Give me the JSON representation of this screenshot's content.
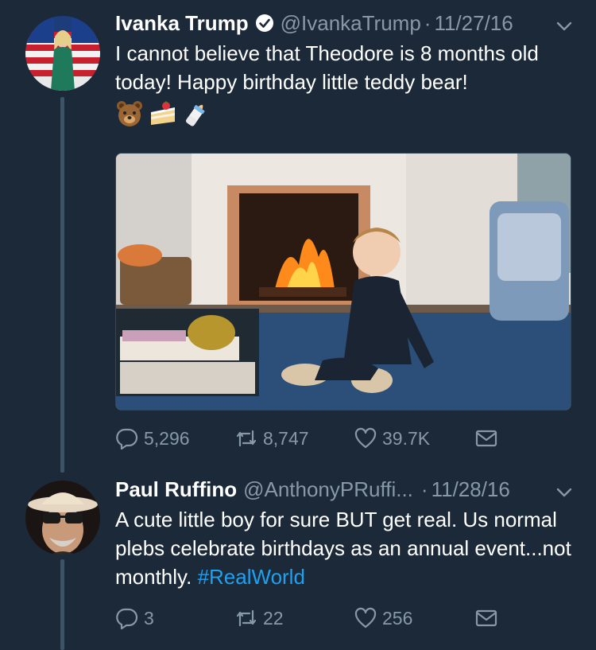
{
  "tweets": [
    {
      "display_name": "Ivanka Trump",
      "handle": "@IvankaTrump",
      "date": "11/27/16",
      "verified": true,
      "text": "I cannot believe that Theodore is 8 months old today! Happy birthday little teddy bear!",
      "emojis": [
        "bear-face-emoji",
        "shortcake-emoji",
        "baby-bottle-emoji"
      ],
      "replies": "5,296",
      "retweets": "8,747",
      "likes": "39.7K",
      "avatar_icon": "ivanka-avatar-icon",
      "media_icon": "fireplace-baby-photo"
    },
    {
      "display_name": "Paul Ruffino",
      "handle": "@AnthonyPRuffi...",
      "date": "11/28/16",
      "verified": false,
      "text_plain": "A cute little boy for sure BUT get real.  Us normal plebs celebrate birthdays as an annual event...not monthly. ",
      "hashtag": "#RealWorld",
      "replies": "3",
      "retweets": "22",
      "likes": "256",
      "avatar_icon": "paul-avatar-icon"
    }
  ],
  "separator": "·",
  "colors": {
    "background": "#1c2938",
    "text": "#ffffff",
    "muted": "#8899a6",
    "link": "#1da1f2",
    "thread_line": "#3d5466"
  }
}
